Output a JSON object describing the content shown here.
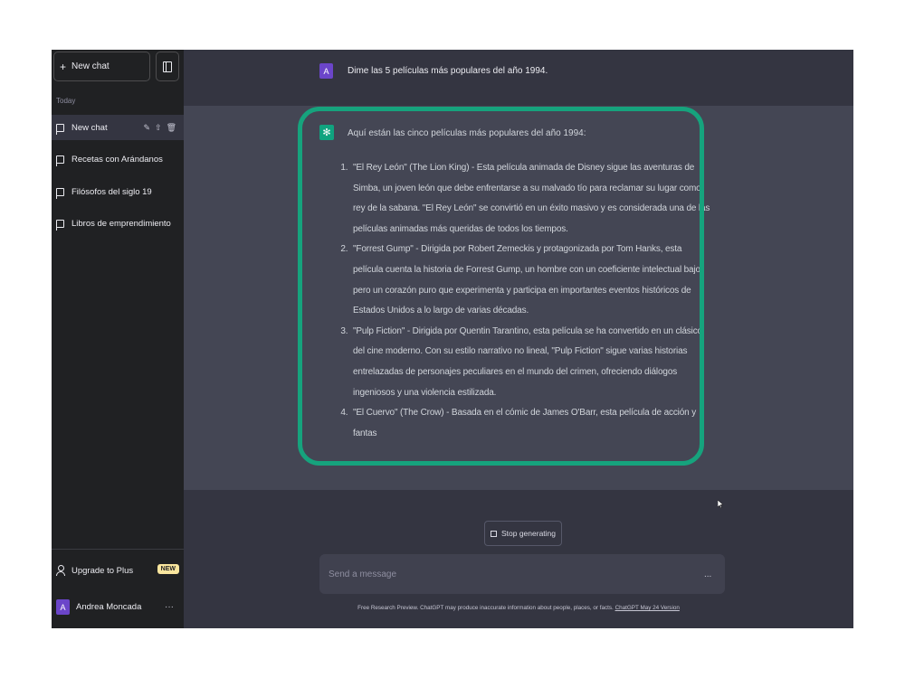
{
  "sidebar": {
    "new_chat": "New chat",
    "section_label": "Today",
    "conversations": [
      {
        "label": "New chat"
      },
      {
        "label": "Recetas con Arándanos"
      },
      {
        "label": "Filósofos del siglo 19"
      },
      {
        "label": "Libros de emprendimiento"
      }
    ],
    "upgrade_label": "Upgrade to Plus",
    "upgrade_badge": "NEW",
    "user": {
      "initial": "A",
      "name": "Andrea Moncada",
      "menu": "···"
    }
  },
  "conversation": {
    "user_message": {
      "avatar_initial": "A",
      "text": "Dime las 5 películas más populares del año 1994."
    },
    "assistant_message": {
      "intro": "Aquí están las cinco películas más populares del año 1994:",
      "items": [
        "\"El Rey León\" (The Lion King) - Esta película animada de Disney sigue las aventuras de Simba, un joven león que debe enfrentarse a su malvado tío para reclamar su lugar como rey de la sabana. \"El Rey León\" se convirtió en un éxito masivo y es considerada una de las películas animadas más queridas de todos los tiempos.",
        "\"Forrest Gump\" - Dirigida por Robert Zemeckis y protagonizada por Tom Hanks, esta película cuenta la historia de Forrest Gump, un hombre con un coeficiente intelectual bajo pero un corazón puro que experimenta y participa en importantes eventos históricos de Estados Unidos a lo largo de varias décadas.",
        "\"Pulp Fiction\" - Dirigida por Quentin Tarantino, esta película se ha convertido en un clásico del cine moderno. Con su estilo narrativo no lineal, \"Pulp Fiction\" sigue varias historias entrelazadas de personajes peculiares en el mundo del crimen, ofreciendo diálogos ingeniosos y una violencia estilizada.",
        "\"El Cuervo\" (The Crow) - Basada en el cómic de James O'Barr, esta película de acción y fantas"
      ]
    }
  },
  "composer": {
    "stop_label": "Stop generating",
    "placeholder": "Send a message",
    "menu": "...",
    "footer_text": "Free Research Preview. ChatGPT may produce inaccurate information about people, places, or facts. ",
    "footer_link": "ChatGPT May 24 Version"
  },
  "colors": {
    "accent": "#10a37f",
    "highlight": "#16a37d",
    "sidebar_bg": "#202123",
    "main_bg": "#343541",
    "assistant_bg": "#444654",
    "avatar": "#6b45c9"
  },
  "icons": [
    "plus-icon",
    "sidebar-toggle-icon",
    "chat-bubble-icon",
    "edit-icon",
    "share-icon",
    "trash-icon",
    "user-icon",
    "chatgpt-logo-icon",
    "stop-icon"
  ]
}
